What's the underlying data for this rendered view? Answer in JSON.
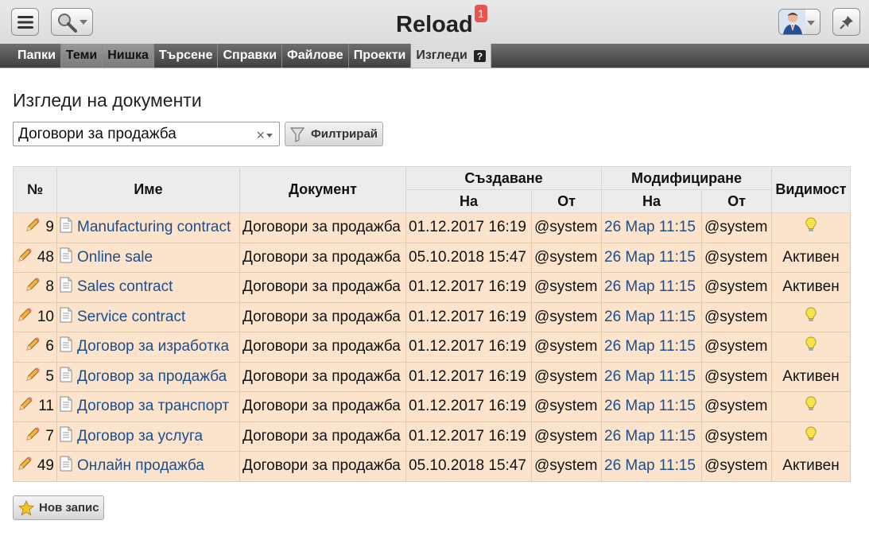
{
  "app": {
    "title": "Reload",
    "notifications": "1"
  },
  "nav": [
    {
      "label": "Папки",
      "style": "normal"
    },
    {
      "label": "Теми",
      "style": "dark"
    },
    {
      "label": "Нишка",
      "style": "dark"
    },
    {
      "label": "Търсене",
      "style": "normal"
    },
    {
      "label": "Справки",
      "style": "normal"
    },
    {
      "label": "Файлове",
      "style": "normal"
    },
    {
      "label": "Проекти",
      "style": "normal"
    },
    {
      "label": "Изгледи",
      "style": "active"
    }
  ],
  "page": {
    "title": "Изгледи на документи",
    "filter_value": "Договори за продажба",
    "filter_clear": "×",
    "filter_button": "Филтрирай",
    "new_button": "Нов запис"
  },
  "table": {
    "headers": {
      "num": "№",
      "name": "Име",
      "document": "Документ",
      "created": "Създаване",
      "modified": "Модифициране",
      "visibility": "Видимост",
      "on": "На",
      "by": "От"
    },
    "rows": [
      {
        "num": "9",
        "name": "Manufacturing contract",
        "document": "Договори за продажба",
        "created_on": "01.12.2017 16:19",
        "created_by": "@system",
        "modified_on": "26 Мар 11:15",
        "modified_by": "@system",
        "visibility": "",
        "bulb": true
      },
      {
        "num": "48",
        "name": "Online sale",
        "document": "Договори за продажба",
        "created_on": "05.10.2018 15:47",
        "created_by": "@system",
        "modified_on": "26 Мар 11:15",
        "modified_by": "@system",
        "visibility": "Активен",
        "bulb": false
      },
      {
        "num": "8",
        "name": "Sales contract",
        "document": "Договори за продажба",
        "created_on": "01.12.2017 16:19",
        "created_by": "@system",
        "modified_on": "26 Мар 11:15",
        "modified_by": "@system",
        "visibility": "Активен",
        "bulb": false
      },
      {
        "num": "10",
        "name": "Service contract",
        "document": "Договори за продажба",
        "created_on": "01.12.2017 16:19",
        "created_by": "@system",
        "modified_on": "26 Мар 11:15",
        "modified_by": "@system",
        "visibility": "",
        "bulb": true
      },
      {
        "num": "6",
        "name": "Договор за изработка",
        "document": "Договори за продажба",
        "created_on": "01.12.2017 16:19",
        "created_by": "@system",
        "modified_on": "26 Мар 11:15",
        "modified_by": "@system",
        "visibility": "",
        "bulb": true
      },
      {
        "num": "5",
        "name": "Договор за продажба",
        "document": "Договори за продажба",
        "created_on": "01.12.2017 16:19",
        "created_by": "@system",
        "modified_on": "26 Мар 11:15",
        "modified_by": "@system",
        "visibility": "Активен",
        "bulb": false
      },
      {
        "num": "11",
        "name": "Договор за транспорт",
        "document": "Договори за продажба",
        "created_on": "01.12.2017 16:19",
        "created_by": "@system",
        "modified_on": "26 Мар 11:15",
        "modified_by": "@system",
        "visibility": "",
        "bulb": true
      },
      {
        "num": "7",
        "name": "Договор за услуга",
        "document": "Договори за продажба",
        "created_on": "01.12.2017 16:19",
        "created_by": "@system",
        "modified_on": "26 Мар 11:15",
        "modified_by": "@system",
        "visibility": "",
        "bulb": true
      },
      {
        "num": "49",
        "name": "Онлайн продажба",
        "document": "Договори за продажба",
        "created_on": "05.10.2018 15:47",
        "created_by": "@system",
        "modified_on": "26 Мар 11:15",
        "modified_by": "@system",
        "visibility": "Активен",
        "bulb": false
      }
    ]
  },
  "icons": {
    "menu": "hamburger-icon",
    "search": "magnifier-icon",
    "user": "user-avatar-icon",
    "pin": "pushpin-icon",
    "help": "question-icon",
    "filter": "funnel-icon",
    "edit": "pencil-icon",
    "doc": "document-icon",
    "visible": "lightbulb-icon",
    "new": "star-icon"
  },
  "colors": {
    "row_bg": "#fbe3cc",
    "link": "#1d4e89",
    "badge": "#e8554e",
    "nav_bg": "#4f4f4f"
  }
}
